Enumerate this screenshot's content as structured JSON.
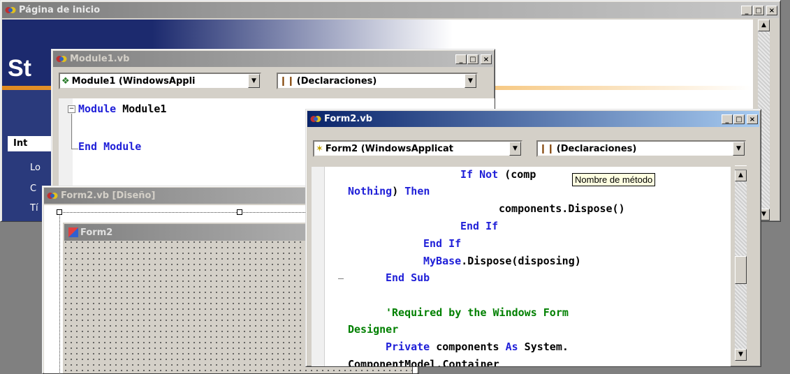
{
  "start_page": {
    "title": "Página de inicio",
    "heading_fragment": "St",
    "nav_items": [
      "Int",
      "Lo",
      "C",
      "Tí"
    ]
  },
  "module_window": {
    "title": "Module1.vb",
    "class_combo": "Module1 (WindowsAppli",
    "member_combo": "(Declaraciones)",
    "code": {
      "line1_kw": "Module",
      "line1_name": " Module1",
      "line2_kw": "End Module"
    }
  },
  "designer_window": {
    "title": "Form2.vb [Diseño]",
    "form_title": "Form2"
  },
  "form2_code_window": {
    "title": "Form2.vb",
    "class_combo": "Form2 (WindowsApplicat",
    "member_combo": "(Declaraciones)",
    "tooltip": "Nombre de método",
    "lines": {
      "l1_kw1": "If",
      "l1_kw2": "Not",
      "l1_rest": "(comp",
      "l2_kw1": "Nothing",
      "l2_mid": ")",
      "l2_kw2": "Then",
      "l3": "components.Dispose()",
      "l4": "End If",
      "l5": "End If",
      "l6_kw": "MyBase",
      "l6_rest": ".Dispose(disposing)",
      "l7": "End Sub",
      "l8": "'Required by the Windows Form",
      "l9": "Designer",
      "l10_kw1": "Private",
      "l10_mid": " components ",
      "l10_kw2": "As",
      "l10_rest": " System.",
      "l11": "ComponentModel.Container"
    }
  },
  "window_buttons": {
    "minimize": "_",
    "maximize": "□",
    "close": "×"
  },
  "scroll_arrows": {
    "up": "▲",
    "down": "▼"
  },
  "combo_arrow": "▼",
  "colors": {
    "active_title": "#0a246a",
    "keyword": "#1f1fd8",
    "comment": "#008000"
  }
}
